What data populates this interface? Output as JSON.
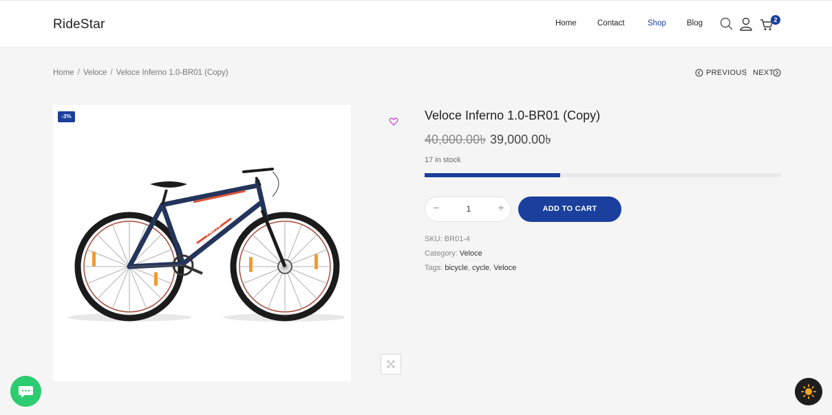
{
  "header": {
    "logo": "RideStar",
    "nav": [
      "Home",
      "Contact",
      "Shop",
      "Blog"
    ],
    "active_nav": "Shop",
    "cart_count": "2"
  },
  "breadcrumb": [
    "Home",
    "Veloce",
    "Veloce Inferno 1.0-BR01 (Copy)"
  ],
  "pagination": {
    "previous": "PREVIOUS",
    "next": "NEXT",
    "separator": "|"
  },
  "product": {
    "badge": "-3%",
    "title": "Veloce Inferno 1.0-BR01 (Copy)",
    "old_price": "40,000.00৳",
    "new_price": "39,000.00৳",
    "stock_text": "17 in stock",
    "stock_fraction": 0.38,
    "quantity": "1",
    "add_to_cart": "ADD TO CART",
    "sku_label": "SKU:",
    "sku": "BR01-4",
    "category_label": "Category:",
    "category": "Veloce",
    "tags_label": "Tags:",
    "tags": [
      "bicycle",
      "cycle",
      "Veloce"
    ],
    "bike_brand_text": "HERO"
  },
  "colors": {
    "accent": "#1a3f9c",
    "chat": "#2ecc71",
    "theme_toggle": "#1e1e1e"
  }
}
